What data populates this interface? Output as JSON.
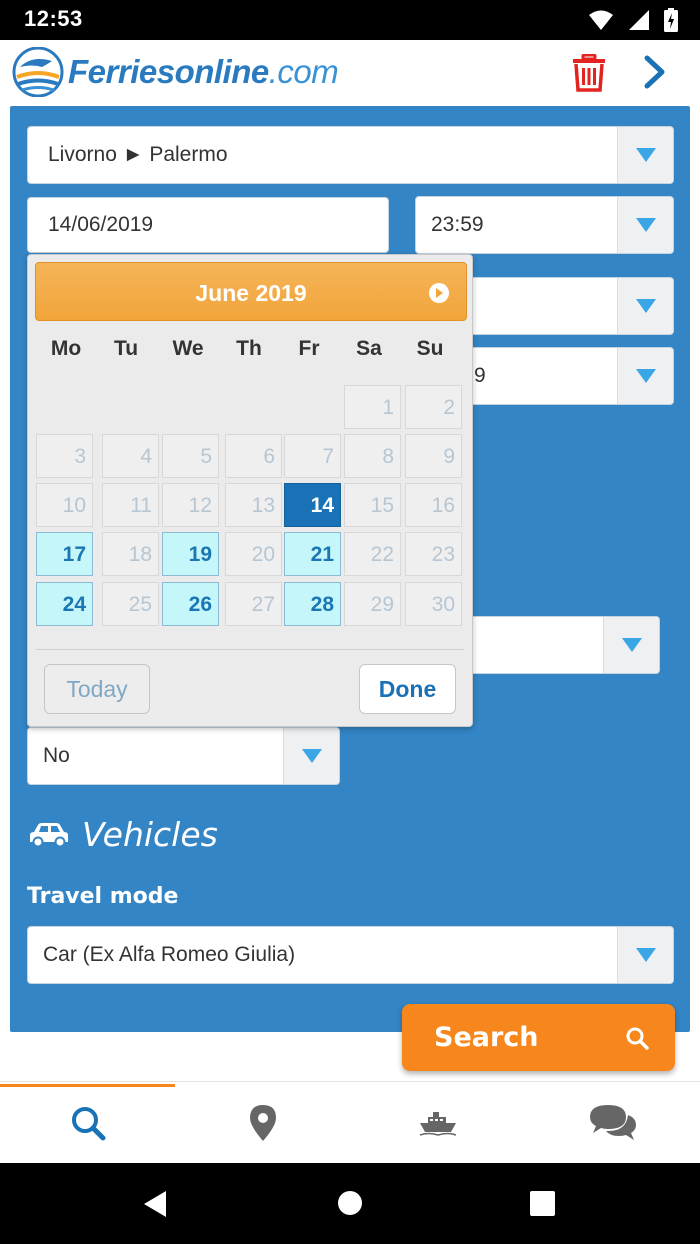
{
  "status_bar": {
    "time": "12:53",
    "icons": [
      "wifi-icon",
      "signal-icon",
      "battery-icon"
    ]
  },
  "header": {
    "logo_bold": "Ferriesonline",
    "logo_suffix": ".com",
    "icons": [
      "trash-icon",
      "chevron-right-icon"
    ]
  },
  "form": {
    "route": "Livorno ► Palermo",
    "date": "14/06/2019",
    "time": "23:59",
    "hidden_field_partial": "9",
    "pets": "No",
    "vehicles_title": "Vehicles",
    "travel_mode_label": "Travel mode",
    "travel_mode": "Car (Ex Alfa Romeo Giulia)"
  },
  "datepicker": {
    "month": "June 2019",
    "weekdays": [
      "Mo",
      "Tu",
      "We",
      "Th",
      "Fr",
      "Sa",
      "Su"
    ],
    "weeks": [
      [
        "",
        "",
        "",
        "",
        "",
        "1",
        "2"
      ],
      [
        "3",
        "4",
        "5",
        "6",
        "7",
        "8",
        "9"
      ],
      [
        "10",
        "11",
        "12",
        "13",
        "14",
        "15",
        "16"
      ],
      [
        "17",
        "18",
        "19",
        "20",
        "21",
        "22",
        "23"
      ],
      [
        "24",
        "25",
        "26",
        "27",
        "28",
        "29",
        "30"
      ]
    ],
    "available_days": [
      "17",
      "19",
      "21",
      "24",
      "26",
      "28"
    ],
    "selected_day": "14",
    "today_label": "Today",
    "done_label": "Done"
  },
  "search_button": {
    "label": "Search"
  },
  "bottom_nav": {
    "items": [
      "search-icon",
      "location-pin-icon",
      "ferry-icon",
      "chat-icon"
    ],
    "active_index": 0
  },
  "colors": {
    "panel_blue": "#3385c6",
    "accent_orange": "#f7871c",
    "selected_day": "#1a72b6",
    "available_day": "#c4f6fa"
  }
}
